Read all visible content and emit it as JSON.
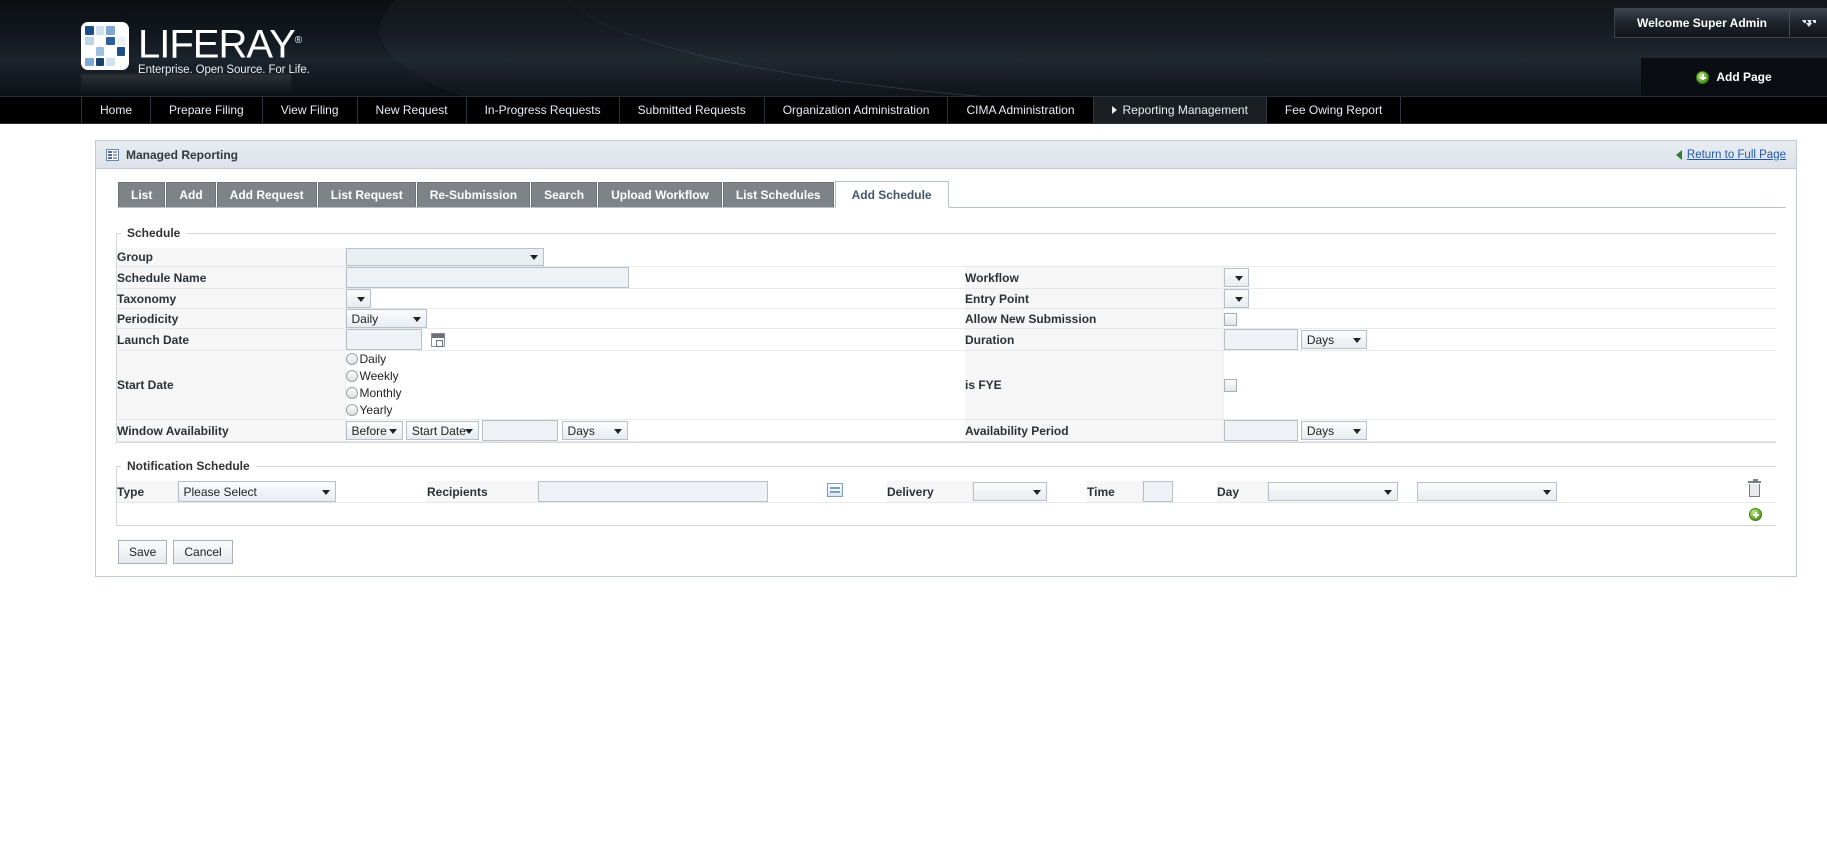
{
  "banner": {
    "logo_word": "LIFERAY",
    "logo_registered": "®",
    "logo_tagline": "Enterprise. Open Source. For Life.",
    "welcome_text": "Welcome Super Admin",
    "add_page_label": "Add Page"
  },
  "nav": {
    "items": [
      {
        "label": "Home",
        "active": false
      },
      {
        "label": "Prepare Filing",
        "active": false
      },
      {
        "label": "View Filing",
        "active": false
      },
      {
        "label": "New Request",
        "active": false
      },
      {
        "label": "In-Progress Requests",
        "active": false
      },
      {
        "label": "Submitted Requests",
        "active": false
      },
      {
        "label": "Organization Administration",
        "active": false
      },
      {
        "label": "CIMA Administration",
        "active": false
      },
      {
        "label": "Reporting Management",
        "active": true
      },
      {
        "label": "Fee Owing Report",
        "active": false
      }
    ]
  },
  "portlet": {
    "title": "Managed Reporting",
    "return_link": "Return to Full Page"
  },
  "tabs": [
    {
      "label": "List",
      "active": false
    },
    {
      "label": "Add",
      "active": false
    },
    {
      "label": "Add Request",
      "active": false
    },
    {
      "label": "List Request",
      "active": false
    },
    {
      "label": "Re-Submission",
      "active": false
    },
    {
      "label": "Search",
      "active": false
    },
    {
      "label": "Upload Workflow",
      "active": false
    },
    {
      "label": "List Schedules",
      "active": false
    },
    {
      "label": "Add Schedule",
      "active": true
    }
  ],
  "schedule": {
    "legend": "Schedule",
    "labels": {
      "group": "Group",
      "schedule_name": "Schedule Name",
      "taxonomy": "Taxonomy",
      "periodicity": "Periodicity",
      "launch_date": "Launch Date",
      "start_date": "Start Date",
      "window_availability": "Window Availability",
      "workflow": "Workflow",
      "entry_point": "Entry Point",
      "allow_new_submission": "Allow New Submission",
      "duration": "Duration",
      "is_fye": "is FYE",
      "availability_period": "Availability Period"
    },
    "values": {
      "group": "",
      "schedule_name": "",
      "taxonomy": "",
      "periodicity": "Daily",
      "launch_date": "",
      "workflow": "",
      "entry_point": "",
      "duration_value": "",
      "duration_unit": "Days",
      "availability_period_value": "",
      "availability_period_unit": "Days",
      "window_relation": "Before",
      "window_anchor": "Start Date",
      "window_amount": "",
      "window_unit": "Days"
    },
    "start_date_options": [
      "Daily",
      "Weekly",
      "Monthly",
      "Yearly"
    ],
    "checkboxes": {
      "allow_new_submission_checked": false,
      "is_fye_checked": false
    }
  },
  "notification": {
    "legend": "Notification Schedule",
    "labels": {
      "type": "Type",
      "recipients": "Recipients",
      "delivery": "Delivery",
      "time": "Time",
      "day": "Day"
    },
    "values": {
      "type": "Please Select",
      "recipients": "",
      "delivery": "",
      "time": "",
      "day": "",
      "day_extra": ""
    }
  },
  "footer": {
    "save_label": "Save",
    "cancel_label": "Cancel"
  }
}
